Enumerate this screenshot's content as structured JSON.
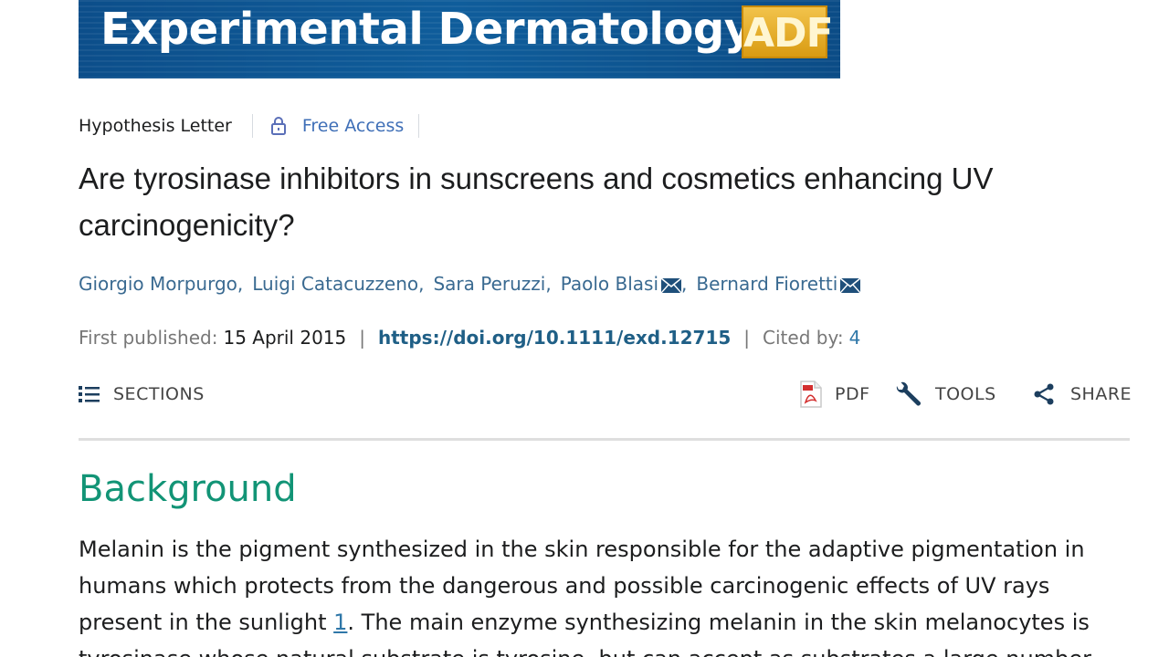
{
  "journal": {
    "name": "Experimental Dermatology",
    "badge": "ADF"
  },
  "article_meta": {
    "type": "Hypothesis Letter",
    "access": "Free Access"
  },
  "title": "Are tyrosinase inhibitors in sunscreens and cosmetics enhancing UV carcinogenicity?",
  "authors": [
    {
      "name": "Giorgio Morpurgo",
      "email_icon": false
    },
    {
      "name": "Luigi Catacuzzeno",
      "email_icon": false
    },
    {
      "name": "Sara Peruzzi",
      "email_icon": false
    },
    {
      "name": "Paolo Blasi",
      "email_icon": true
    },
    {
      "name": "Bernard Fioretti",
      "email_icon": true
    }
  ],
  "publication": {
    "first_published_label": "First published:",
    "first_published_date": "15 April 2015",
    "doi": "https://doi.org/10.1111/exd.12715",
    "cited_by_label": "Cited by:",
    "cited_by_count": "4"
  },
  "toolbar": {
    "sections": "SECTIONS",
    "pdf": "PDF",
    "tools": "TOOLS",
    "share": "SHARE"
  },
  "section": {
    "heading": "Background",
    "para_part1": "Melanin is the pigment synthesized in the skin responsible for the adaptive pigmentation in humans which protects from the dangerous and possible carcinogenic effects of UV rays present in the sunlight ",
    "ref1": "1",
    "para_part2": ". The main enzyme synthesizing melanin in the skin melanocytes is tyrosinase whose natural substrate is tyrosine, but can accept as substrates a large number"
  },
  "colors": {
    "link": "#3a6a91",
    "doi": "#1f5f86",
    "heading": "#129476",
    "free_access": "#3f6fb7"
  }
}
